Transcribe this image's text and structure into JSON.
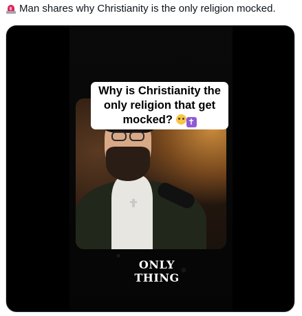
{
  "post": {
    "text": "Man shares why Christianity is the only religion mocked.",
    "leading_icon": "police-siren-icon"
  },
  "media": {
    "caption_text": "Why is Christianity the only religion that get mocked?",
    "caption_emojis": [
      "flushed-face-emoji",
      "latin-cross-emoji"
    ],
    "subtitle": "ONLY THING"
  }
}
